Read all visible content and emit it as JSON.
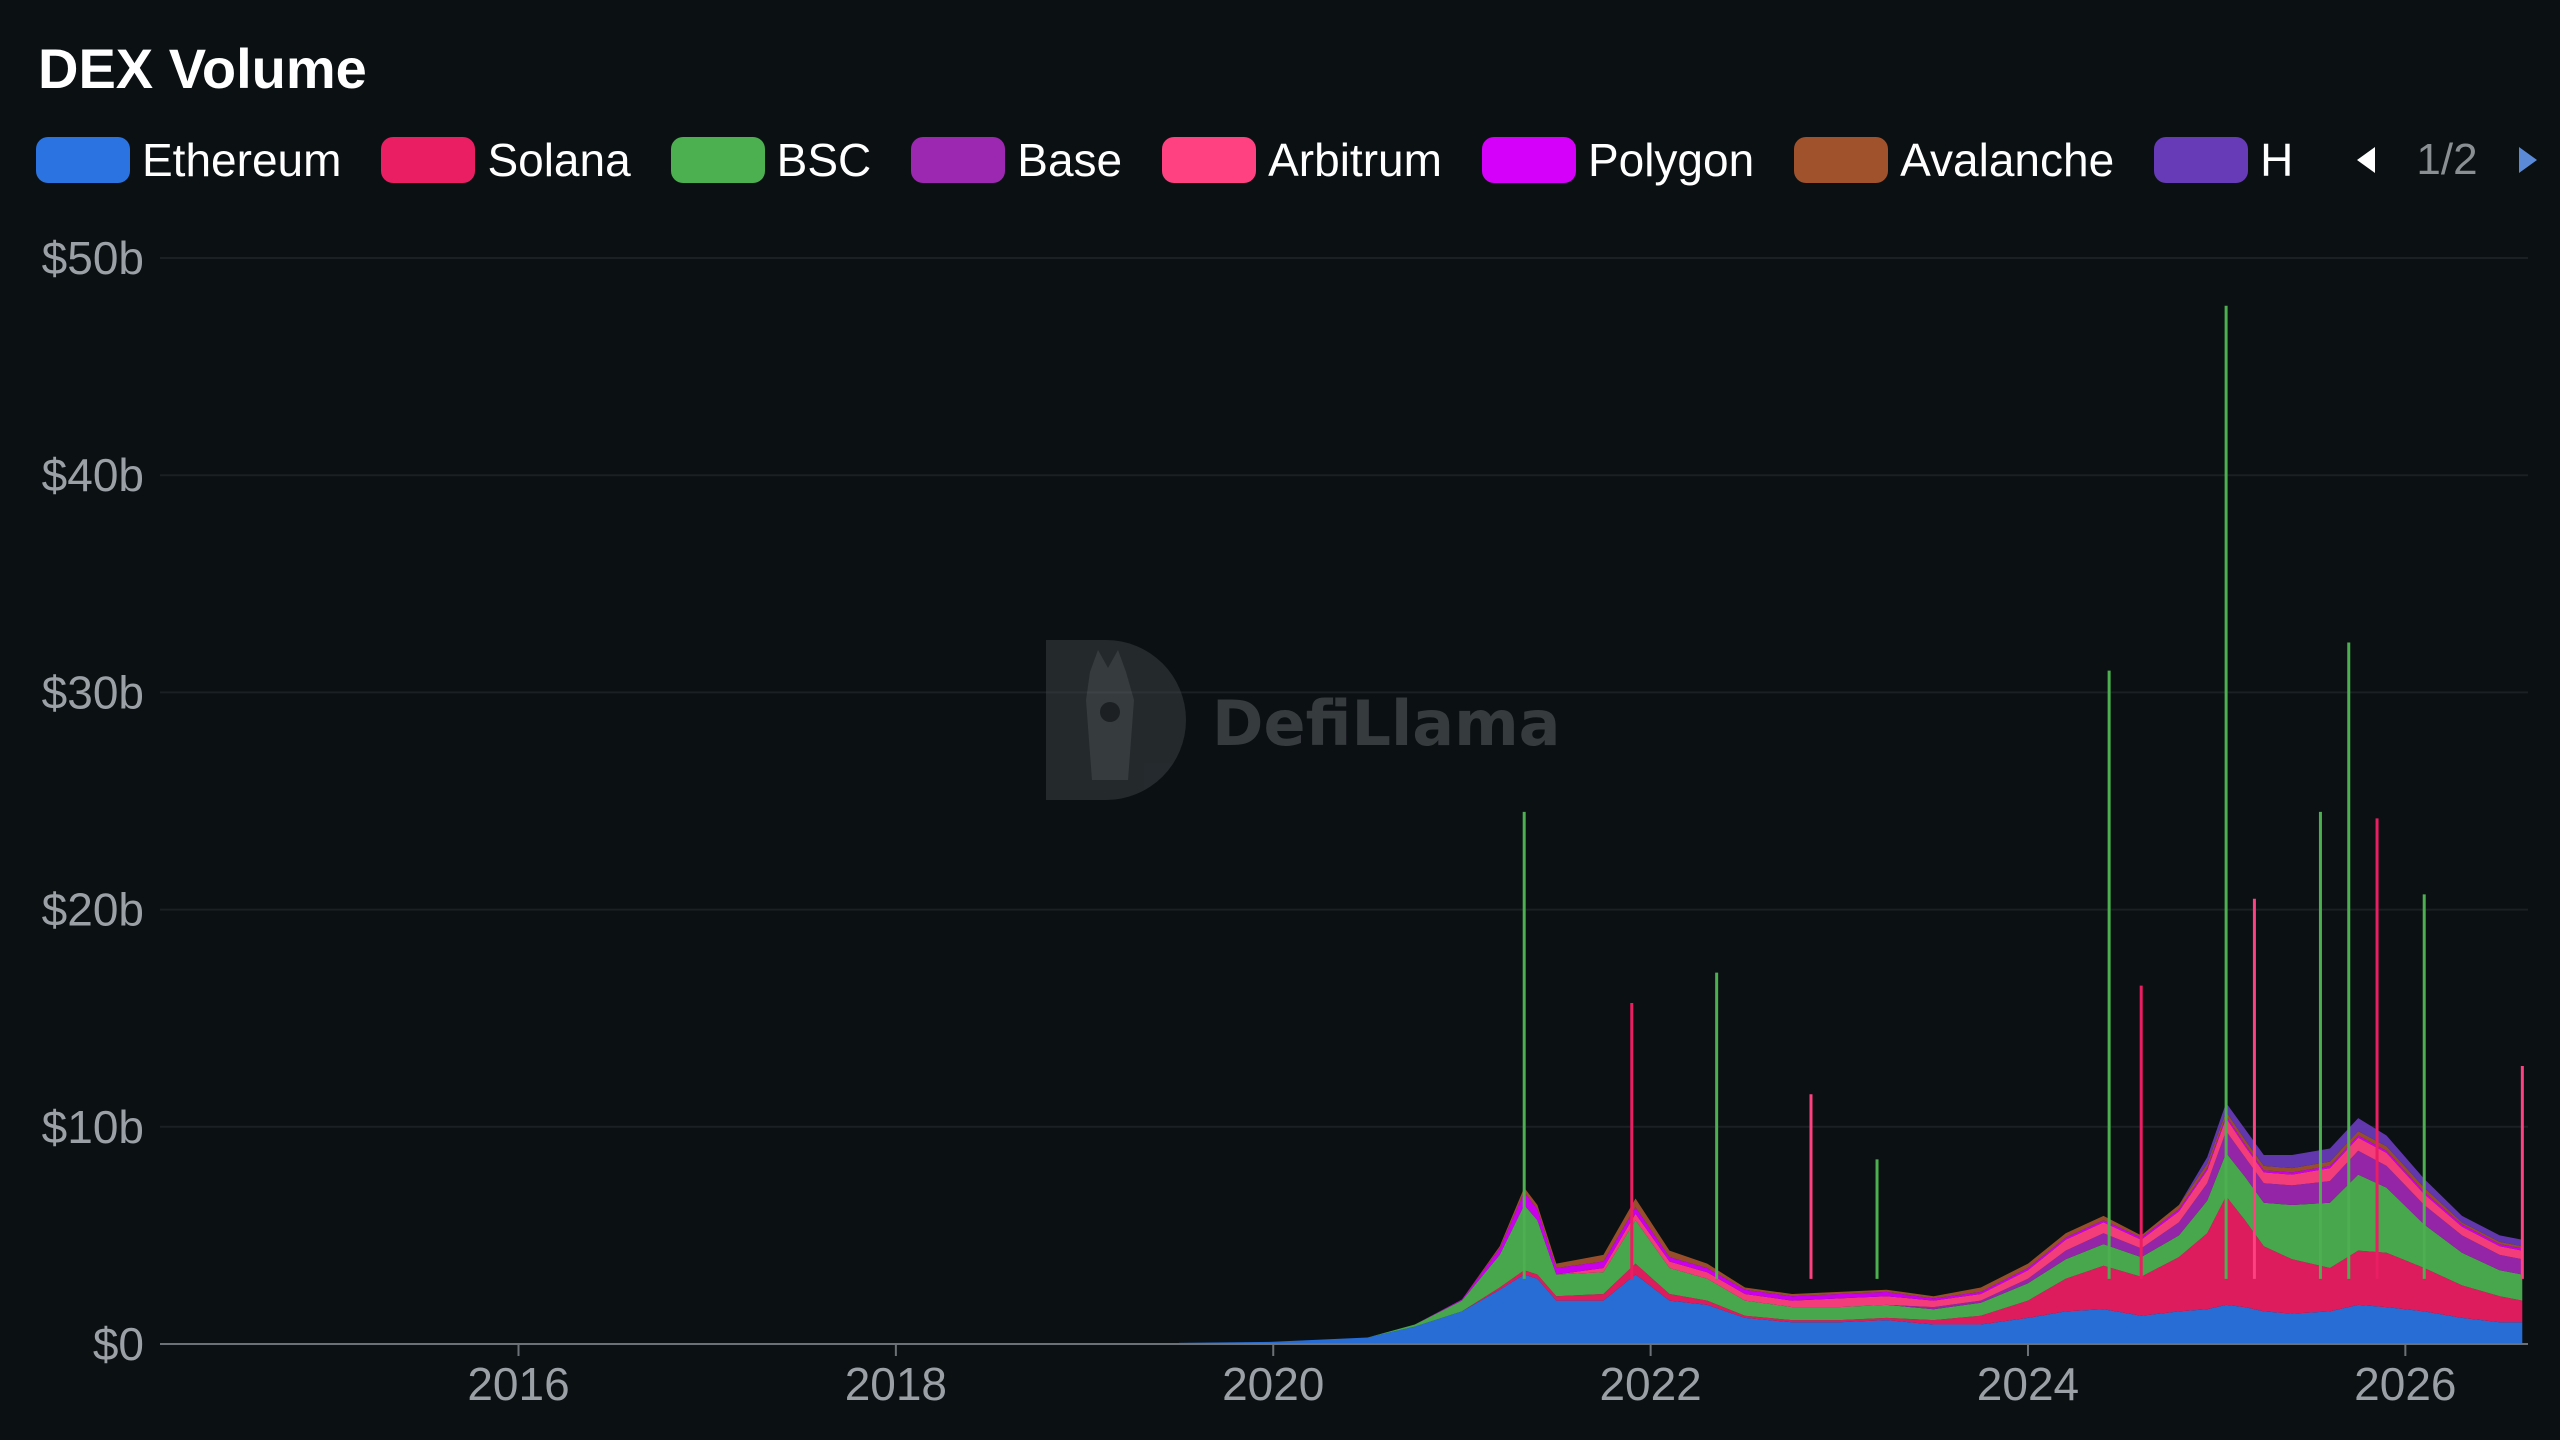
{
  "title": "DEX Volume",
  "legend": {
    "items": [
      {
        "label": "Ethereum",
        "color": "#2a73e0"
      },
      {
        "label": "Solana",
        "color": "#e91e63"
      },
      {
        "label": "BSC",
        "color": "#4caf50"
      },
      {
        "label": "Base",
        "color": "#9c27b0"
      },
      {
        "label": "Arbitrum",
        "color": "#ff4081"
      },
      {
        "label": "Polygon",
        "color": "#d500f9"
      },
      {
        "label": "Avalanche",
        "color": "#a0522d"
      },
      {
        "label": "H",
        "color": "#673ab7"
      }
    ],
    "page_label": "1/2",
    "prev_icon": "triangle-left-icon",
    "next_icon": "triangle-right-icon"
  },
  "watermark": {
    "text": "DefiLlama",
    "icon": "llama-logo-icon"
  },
  "chart_data": {
    "type": "area",
    "stacked": true,
    "title": "DEX Volume",
    "xlabel": "",
    "ylabel": "",
    "xlim": [
      2014.1,
      2026.65
    ],
    "ylim": [
      0,
      50
    ],
    "x_ticks": [
      2016,
      2018,
      2020,
      2022,
      2024,
      2026
    ],
    "x_tick_labels": [
      "2016",
      "2018",
      "2020",
      "2022",
      "2024",
      "2026"
    ],
    "y_ticks": [
      0,
      10,
      20,
      30,
      40,
      50
    ],
    "y_tick_labels": [
      "$0",
      "$10b",
      "$20b",
      "$30b",
      "$40b",
      "$50b"
    ],
    "grid": true,
    "legend_position": "top",
    "series_order": [
      "Ethereum",
      "Solana",
      "BSC",
      "Base",
      "Arbitrum",
      "Polygon",
      "Avalanche",
      "H"
    ],
    "x": [
      2019.5,
      2020.0,
      2020.5,
      2020.75,
      2021.0,
      2021.2,
      2021.33,
      2021.4,
      2021.5,
      2021.75,
      2021.92,
      2022.1,
      2022.3,
      2022.5,
      2022.75,
      2023.0,
      2023.25,
      2023.5,
      2023.75,
      2024.0,
      2024.2,
      2024.4,
      2024.6,
      2024.8,
      2024.95,
      2025.05,
      2025.15,
      2025.25,
      2025.4,
      2025.6,
      2025.75,
      2025.9,
      2026.1,
      2026.3,
      2026.5,
      2026.62
    ],
    "series": [
      {
        "name": "Ethereum",
        "values": [
          0.05,
          0.1,
          0.3,
          0.8,
          1.5,
          2.5,
          3.2,
          3.0,
          2.0,
          2.0,
          3.2,
          2.0,
          1.8,
          1.2,
          1.0,
          1.0,
          1.1,
          0.9,
          0.9,
          1.2,
          1.5,
          1.6,
          1.3,
          1.5,
          1.6,
          1.8,
          1.7,
          1.5,
          1.4,
          1.5,
          1.8,
          1.7,
          1.5,
          1.2,
          1.0,
          1.0
        ]
      },
      {
        "name": "Solana",
        "values": [
          0,
          0,
          0,
          0,
          0,
          0.1,
          0.2,
          0.2,
          0.2,
          0.3,
          0.5,
          0.3,
          0.2,
          0.1,
          0.1,
          0.1,
          0.1,
          0.2,
          0.4,
          0.8,
          1.5,
          2.0,
          1.8,
          2.5,
          3.5,
          5.0,
          4.0,
          3.0,
          2.5,
          2.0,
          2.5,
          2.5,
          2.0,
          1.5,
          1.2,
          1.0
        ]
      },
      {
        "name": "BSC",
        "values": [
          0,
          0,
          0,
          0.1,
          0.5,
          1.5,
          3.0,
          2.5,
          1.0,
          1.0,
          2.0,
          1.2,
          1.0,
          0.7,
          0.6,
          0.6,
          0.6,
          0.5,
          0.6,
          0.8,
          0.9,
          1.0,
          0.9,
          1.0,
          1.5,
          2.0,
          2.0,
          2.0,
          2.5,
          3.0,
          3.5,
          3.0,
          2.0,
          1.5,
          1.2,
          1.2
        ]
      },
      {
        "name": "Base",
        "values": [
          0,
          0,
          0,
          0,
          0,
          0,
          0,
          0,
          0,
          0,
          0,
          0,
          0,
          0,
          0,
          0,
          0,
          0.1,
          0.1,
          0.2,
          0.4,
          0.5,
          0.4,
          0.6,
          0.8,
          1.0,
          0.9,
          0.9,
          0.9,
          1.0,
          1.1,
          1.0,
          0.9,
          0.8,
          0.7,
          0.7
        ]
      },
      {
        "name": "Arbitrum",
        "values": [
          0,
          0,
          0,
          0,
          0,
          0,
          0,
          0,
          0,
          0.2,
          0.3,
          0.3,
          0.3,
          0.3,
          0.3,
          0.4,
          0.4,
          0.3,
          0.3,
          0.4,
          0.5,
          0.5,
          0.4,
          0.5,
          0.6,
          0.6,
          0.5,
          0.5,
          0.5,
          0.6,
          0.6,
          0.6,
          0.5,
          0.4,
          0.4,
          0.4
        ]
      },
      {
        "name": "Polygon",
        "values": [
          0,
          0,
          0,
          0,
          0.05,
          0.3,
          0.6,
          0.5,
          0.3,
          0.3,
          0.3,
          0.2,
          0.2,
          0.2,
          0.2,
          0.2,
          0.2,
          0.1,
          0.1,
          0.1,
          0.1,
          0.1,
          0.1,
          0.1,
          0.1,
          0.1,
          0.1,
          0.1,
          0.1,
          0.1,
          0.1,
          0.1,
          0.1,
          0.1,
          0.1,
          0.1
        ]
      },
      {
        "name": "Avalanche",
        "values": [
          0,
          0,
          0,
          0,
          0,
          0.1,
          0.2,
          0.2,
          0.2,
          0.3,
          0.4,
          0.3,
          0.2,
          0.1,
          0.1,
          0.1,
          0.1,
          0.1,
          0.2,
          0.2,
          0.2,
          0.2,
          0.1,
          0.2,
          0.2,
          0.2,
          0.2,
          0.2,
          0.2,
          0.2,
          0.2,
          0.2,
          0.2,
          0.1,
          0.1,
          0.1
        ]
      },
      {
        "name": "H",
        "values": [
          0,
          0,
          0,
          0,
          0,
          0,
          0,
          0,
          0,
          0,
          0,
          0,
          0,
          0,
          0,
          0,
          0,
          0,
          0,
          0,
          0,
          0,
          0,
          0,
          0.3,
          0.4,
          0.5,
          0.5,
          0.6,
          0.6,
          0.6,
          0.5,
          0.4,
          0.3,
          0.3,
          0.3
        ]
      }
    ],
    "spikes": [
      {
        "x": 2021.33,
        "total": 24.5
      },
      {
        "x": 2021.9,
        "total": 15.7
      },
      {
        "x": 2022.35,
        "total": 17.1
      },
      {
        "x": 2022.85,
        "total": 11.5
      },
      {
        "x": 2023.2,
        "total": 8.5
      },
      {
        "x": 2024.43,
        "total": 31.0
      },
      {
        "x": 2024.6,
        "total": 16.5
      },
      {
        "x": 2025.05,
        "total": 47.8
      },
      {
        "x": 2025.2,
        "total": 20.5
      },
      {
        "x": 2025.55,
        "total": 24.5
      },
      {
        "x": 2025.7,
        "total": 32.3
      },
      {
        "x": 2025.85,
        "total": 24.2
      },
      {
        "x": 2026.1,
        "total": 20.7
      },
      {
        "x": 2026.62,
        "total": 12.8
      }
    ]
  }
}
